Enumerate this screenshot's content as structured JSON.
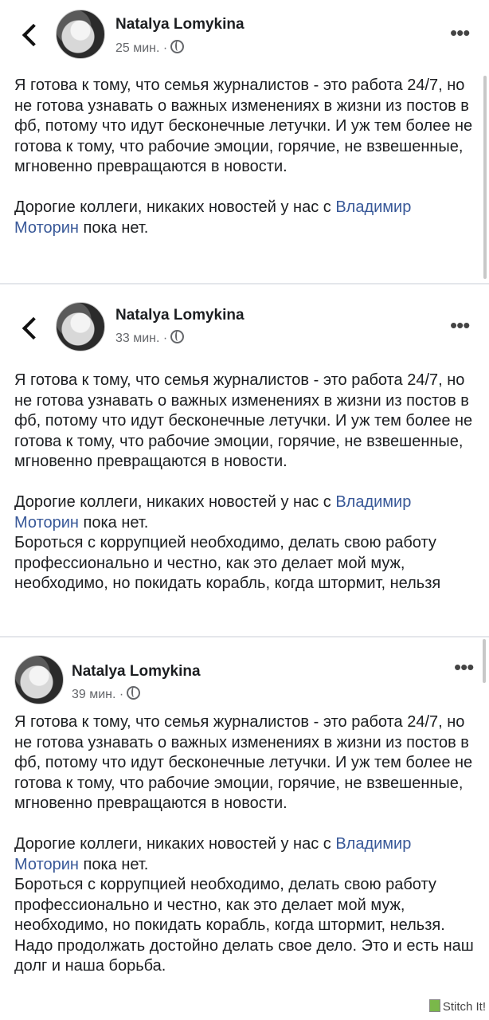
{
  "posts": [
    {
      "author": "Natalya Lomykina",
      "time": "25 мин. ·",
      "text": {
        "p1": "Я готова к тому, что семья журналистов - это работа 24/7, но не готова узнавать о важных изменениях в жизни из постов в фб, потому что идут бесконечные летучки. И уж тем более не готова к тому, что рабочие эмоции, горячие, не взвешенные, мгновенно превращаются в новости.",
        "p2_before": "Дорогие коллеги, никаких новостей у нас с ",
        "p2_link": "Владимир Моторин",
        "p2_after": " пока нет."
      }
    },
    {
      "author": "Natalya Lomykina",
      "time": "33 мин. ·",
      "text": {
        "p1": "Я готова к тому, что семья журналистов - это работа 24/7, но не готова узнавать о важных изменениях в жизни из постов в фб, потому что идут бесконечные летучки. И уж тем более не готова к тому, что рабочие эмоции, горячие, не взвешенные, мгновенно превращаются в новости.",
        "p2_before": "Дорогие коллеги, никаких новостей у нас с ",
        "p2_link": "Владимир Моторин",
        "p2_after": " пока нет.",
        "p3": "Бороться с коррупцией необходимо, делать свою работу профессионально и честно, как это делает мой муж, необходимо, но покидать корабль, когда штормит, нельзя"
      }
    },
    {
      "author": "Natalya Lomykina",
      "time": "39 мин. ·",
      "text": {
        "p1": "Я готова к тому, что семья журналистов - это работа 24/7, но не готова узнавать о важных изменениях в жизни из постов в фб, потому что идут бесконечные летучки. И уж тем более не готова к тому, что рабочие эмоции, горячие, не взвешенные, мгновенно превращаются в новости.",
        "p2_before": "Дорогие коллеги, никаких новостей у нас с ",
        "p2_link": "Владимир Моторин",
        "p2_after": " пока нет.",
        "p3": "Бороться с коррупцией необходимо, делать свою работу профессионально и честно, как это делает мой муж, необходимо, но покидать корабль, когда штормит, нельзя. Надо продолжать достойно делать свое дело. Это и есть наш долг и наша борьба."
      }
    }
  ],
  "watermark": "Stitch It!",
  "icons": {
    "back": "chevron-left-icon",
    "more": "more-horizontal-icon",
    "privacy": "globe-icon",
    "watermark": "stitch-logo-icon"
  }
}
